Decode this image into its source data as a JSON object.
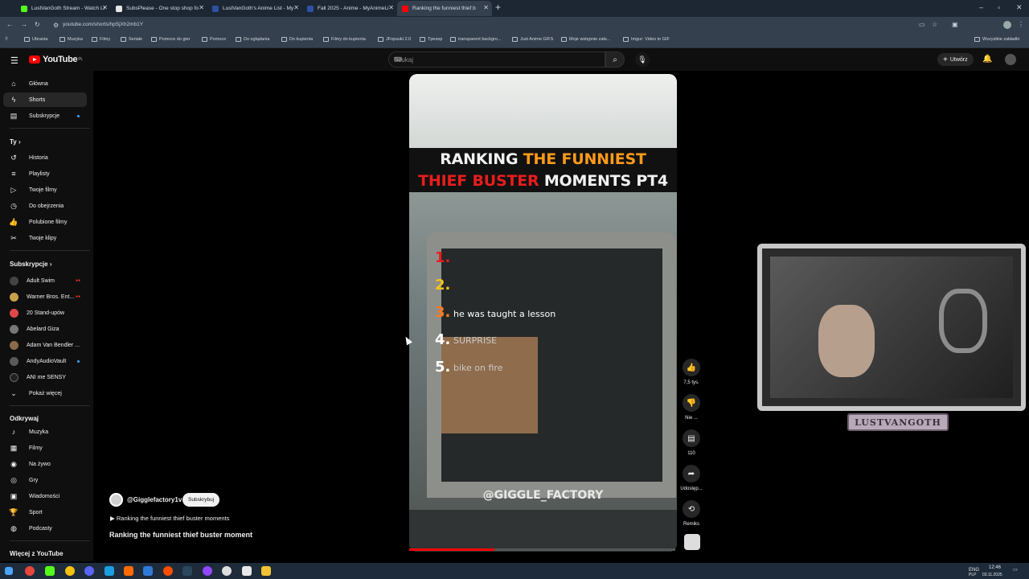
{
  "browser": {
    "tabs": [
      {
        "title": "LustVanGoth Stream - Watch Li",
        "fav_color": "#53fc18"
      },
      {
        "title": "SubsPlease - One stop shop fo",
        "fav_color": "#e6e6e6"
      },
      {
        "title": "LustVanGoth's Anime List - My",
        "fav_color": "#2e51a2"
      },
      {
        "title": "Fall 2025 - Anime - MyAnimeLi",
        "fav_color": "#2e51a2"
      },
      {
        "title": "Ranking the funniest thief b",
        "fav_color": "#ff0000"
      }
    ],
    "new_tab_icon": "+",
    "url": "youtube.com/shorts/hpSjXh2mb1Y",
    "bookmarks": [
      "Ubrania",
      "Muzyka",
      "Filmy",
      "Seriale",
      "Pomoce do gier",
      "Pomoce",
      "Do oglądania",
      "Do kupienia",
      "Filmy do kupienia",
      "JFopsuki 2.0",
      "Tpexep",
      "transparent backgro...",
      "Just Anime GIFS",
      "Moje wstępnie załe...",
      "Imgur: Video to GIF"
    ],
    "bookmarks_right": "Wszystkie zakładki"
  },
  "youtube": {
    "logo": "YouTube",
    "logo_region": "PL",
    "search_placeholder": "Szukaj",
    "create_label": "Utwórz",
    "accent": "#ff0000"
  },
  "sidebar": {
    "main": [
      {
        "label": "Główna",
        "icon": "home-icon"
      },
      {
        "label": "Shorts",
        "icon": "shorts-icon"
      },
      {
        "label": "Subskrypcje",
        "icon": "subscriptions-icon"
      }
    ],
    "you_header": "Ty",
    "you": [
      {
        "label": "Historia",
        "icon": "history-icon"
      },
      {
        "label": "Playlisty",
        "icon": "playlists-icon"
      },
      {
        "label": "Twoje filmy",
        "icon": "your-videos-icon"
      },
      {
        "label": "Do obejrzenia",
        "icon": "watch-later-icon"
      },
      {
        "label": "Polubione filmy",
        "icon": "liked-icon"
      },
      {
        "label": "Twoje klipy",
        "icon": "clips-icon"
      }
    ],
    "subs_header": "Subskrypcje",
    "subs": [
      {
        "label": "Adult Swim",
        "color": "#444444",
        "live": "●●"
      },
      {
        "label": "Warner Bros. Ent...",
        "color": "#c8a24a",
        "live": "●●"
      },
      {
        "label": "20 Stand-upów",
        "color": "#e04848",
        "live": ""
      },
      {
        "label": "Abelard Giza",
        "color": "#777777",
        "live": ""
      },
      {
        "label": "Adam Van Bendler ...",
        "color": "#8a6a4a",
        "live": ""
      },
      {
        "label": "AndyAudioVault",
        "color": "#5a5a5a",
        "live": ""
      },
      {
        "label": "ANI me SENSY",
        "color": "#222222",
        "live": ""
      }
    ],
    "show_more": "Pokaż więcej",
    "explore_header": "Odkrywaj",
    "explore": [
      {
        "label": "Muzyka",
        "icon": "music-icon"
      },
      {
        "label": "Filmy",
        "icon": "movies-icon"
      },
      {
        "label": "Na żywo",
        "icon": "live-icon"
      },
      {
        "label": "Gry",
        "icon": "gaming-icon"
      },
      {
        "label": "Wiadomości",
        "icon": "news-icon"
      },
      {
        "label": "Sport",
        "icon": "sport-icon"
      },
      {
        "label": "Podcasty",
        "icon": "podcasts-icon"
      }
    ],
    "more_header": "Więcej z YouTube"
  },
  "short": {
    "title_line1_white": "RANKING",
    "title_line1_orange": "THE FUNNIEST",
    "title_line2_red": "THIEF BUSTER",
    "title_line2_white": "MOMENTS PT4",
    "ranks": [
      {
        "num": "1.",
        "text": "",
        "color": "#e81d1d"
      },
      {
        "num": "2.",
        "text": "",
        "color": "#f3c21b"
      },
      {
        "num": "3.",
        "text": "he was taught a lesson",
        "color": "#ff7a1a"
      },
      {
        "num": "4.",
        "text": "SURPRISE",
        "color": "#ffffff"
      },
      {
        "num": "5.",
        "text": "bike on fire",
        "color": "#ffffff"
      }
    ],
    "watermark": "@GIGGLE_FACTORY",
    "progress": 0.32
  },
  "actions": {
    "likes": "7,5 tys.",
    "dislike": "Nie ...",
    "comments": "110",
    "share": "Udostęp...",
    "remix": "Remiks"
  },
  "channel": {
    "name": "@Gigglefactory1v",
    "subscribe": "Subskrybuj",
    "music": "Ranking the funniest thief buster moments",
    "video_title": "Ranking the funniest thief buster moment"
  },
  "webcam": {
    "name": "LUSTVANGOTH"
  },
  "taskbar": {
    "lang": "ENG",
    "lang2": "PLP",
    "time": "12:46",
    "date": "03.11.2025"
  }
}
